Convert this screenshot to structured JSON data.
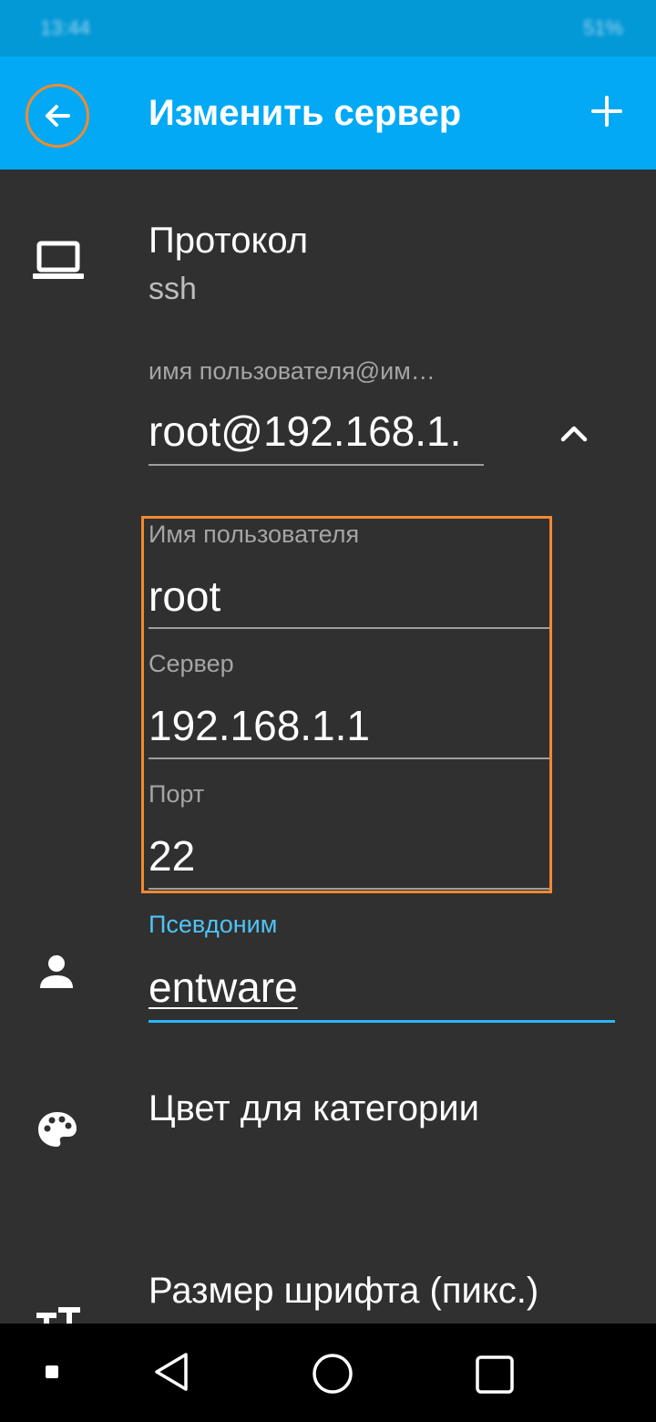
{
  "status_bar": {
    "time": "13:44",
    "right": "51%"
  },
  "app_bar": {
    "title": "Изменить сервер",
    "back_icon": "arrow-left-icon",
    "add_icon": "plus-icon"
  },
  "protocol": {
    "icon": "laptop-icon",
    "label": "Протокол",
    "value": "ssh"
  },
  "address": {
    "label": "имя пользователя@им…",
    "value": "root@192.168.1.",
    "toggle_icon": "chevron-up-icon"
  },
  "details": {
    "username_label": "Имя пользователя",
    "username_value": "root",
    "server_label": "Сервер",
    "server_value": "192.168.1.1",
    "port_label": "Порт",
    "port_value": "22"
  },
  "alias": {
    "icon": "person-icon",
    "label": "Псевдоним",
    "value": "entware"
  },
  "color": {
    "icon": "palette-icon",
    "label": "Цвет для категории"
  },
  "font_size": {
    "icon": "text-size-icon",
    "label": "Размер шрифта (пикс.)"
  },
  "nav": {
    "icons": [
      "square-small-icon",
      "back-triangle-icon",
      "home-circle-icon",
      "recents-square-icon"
    ]
  },
  "colors": {
    "app_bar": "#03a9f4",
    "background": "#303030",
    "highlight": "#f08a30",
    "accent": "#4fc3f7"
  }
}
